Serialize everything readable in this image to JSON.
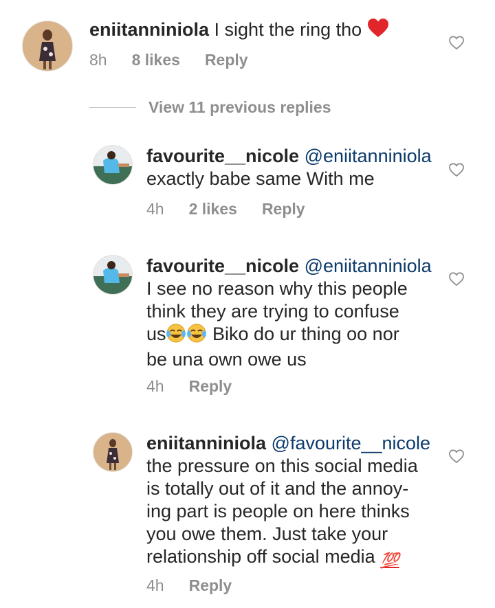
{
  "comments": [
    {
      "username": "eniitanniniola",
      "mention": "",
      "text": "I sight the ring tho",
      "emoji": "heart-emoji",
      "time": "8h",
      "likes": "8 likes",
      "reply": "Reply"
    },
    {
      "username": "favourite__nicole",
      "mention": "@eniitanniniola",
      "text": "exactly babe same With me",
      "time": "4h",
      "likes": "2 likes",
      "reply": "Reply"
    },
    {
      "username": "favourite__nicole",
      "mention": "@eniitanniniola",
      "text_line1": "I see no reason why this people",
      "text_line2": "think they are trying to confuse",
      "text_line3a": "us",
      "text_line3b": " Biko do ur thing oo nor",
      "text_line4": "be una own owe us",
      "emoji": "tears-of-joy-emoji",
      "time": "4h",
      "reply": "Reply"
    },
    {
      "username": "eniitanniniola",
      "mention": "@favourite__nicole",
      "text_line1": "the pressure on this social media",
      "text_line2": "is totally out of it and the annoy-",
      "text_line3": "ing part is people on here thinks",
      "text_line4": "you owe them. Just take your",
      "text_line5": "relationship off social media",
      "emoji": "hundred-points-emoji",
      "emoji_text": "💯",
      "time": "4h",
      "reply": "Reply"
    }
  ],
  "view_replies": "View 11 previous replies",
  "colors": {
    "text": "#262626",
    "meta": "#8e8e8e",
    "mention": "#0b3a6b",
    "heart_emoji": "#e0262b"
  },
  "icons": [
    "heart-outline-icon",
    "heart-emoji",
    "tears-of-joy-emoji",
    "hundred-points-emoji"
  ]
}
